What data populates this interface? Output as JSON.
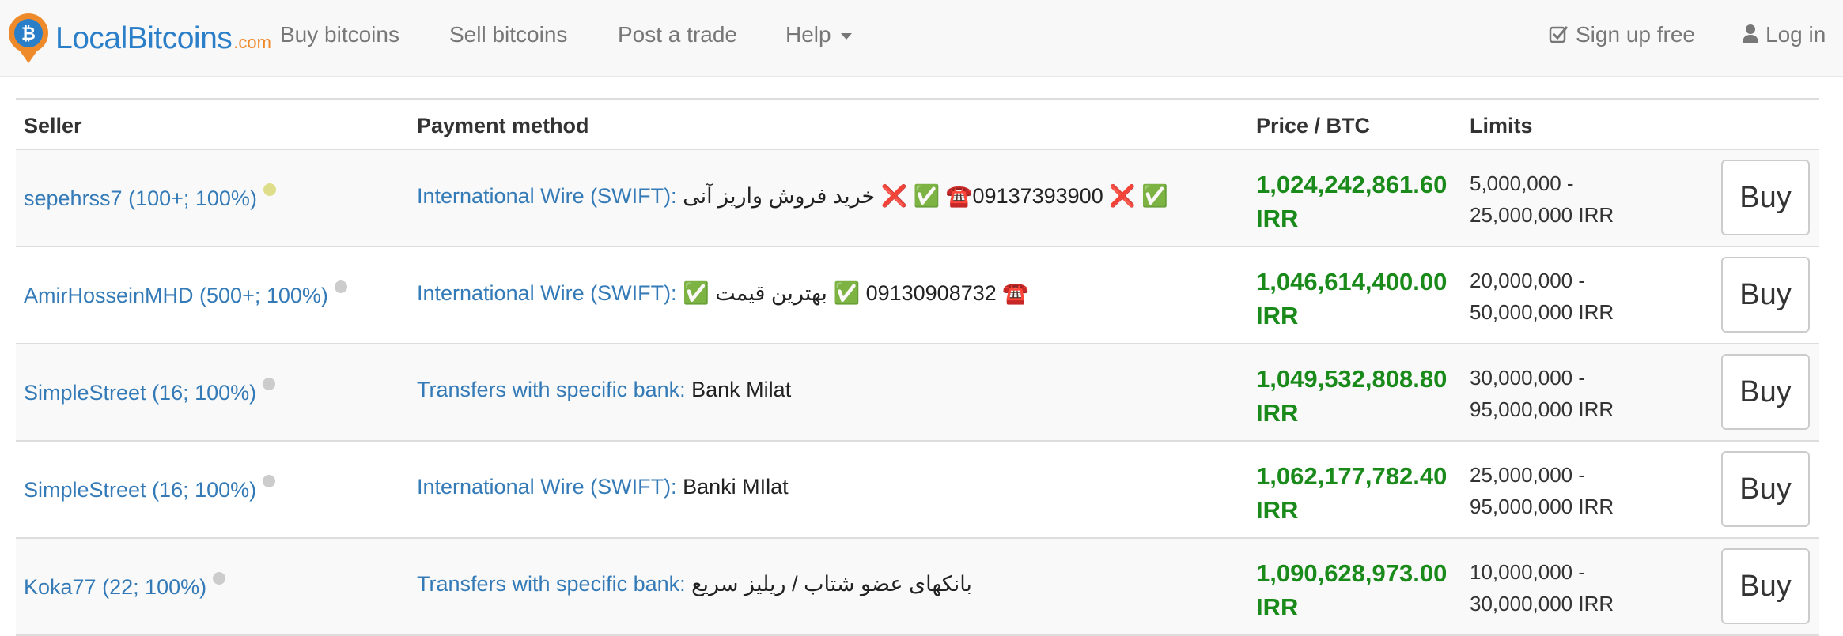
{
  "brand": {
    "name": "LocalBitcoins",
    "tld": ".com"
  },
  "nav": {
    "buy": "Buy bitcoins",
    "sell": "Sell bitcoins",
    "post": "Post a trade",
    "help": "Help",
    "signup": "Sign up free",
    "login": "Log in"
  },
  "colors": {
    "link": "#337ab7",
    "price": "#1a8a1a",
    "brand": "#2b7fc9",
    "brand_accent": "#ef8a2b"
  },
  "table": {
    "headers": {
      "seller": "Seller",
      "payment": "Payment method",
      "price": "Price / BTC",
      "limits": "Limits"
    },
    "rows": [
      {
        "seller": "sepehrss7 (100+; 100%)",
        "status_color": "#dede8a",
        "method": "International Wire (SWIFT):",
        "details": "✅ ❌ 09137393900☎️ ✅ ❌ خرید فروش واریز آنی",
        "price": "1,024,242,861.60",
        "currency": "IRR",
        "limit_min": "5,000,000 -",
        "limit_max": "25,000,000 IRR",
        "buy": "Buy"
      },
      {
        "seller": "AmirHosseinMHD (500+; 100%)",
        "status_color": "#cccccc",
        "method": "International Wire (SWIFT):",
        "details": "☎️ 09130908732 ✅ بهترین قیمت ✅",
        "price": "1,046,614,400.00",
        "currency": "IRR",
        "limit_min": "20,000,000 -",
        "limit_max": "50,000,000 IRR",
        "buy": "Buy"
      },
      {
        "seller": "SimpleStreet (16; 100%)",
        "status_color": "#cccccc",
        "method": "Transfers with specific bank:",
        "details": "Bank Milat",
        "price": "1,049,532,808.80",
        "currency": "IRR",
        "limit_min": "30,000,000 -",
        "limit_max": "95,000,000 IRR",
        "buy": "Buy"
      },
      {
        "seller": "SimpleStreet (16; 100%)",
        "status_color": "#cccccc",
        "method": "International Wire (SWIFT):",
        "details": "Banki MIlat",
        "price": "1,062,177,782.40",
        "currency": "IRR",
        "limit_min": "25,000,000 -",
        "limit_max": "95,000,000 IRR",
        "buy": "Buy"
      },
      {
        "seller": "Koka77 (22; 100%)",
        "status_color": "#cccccc",
        "method": "Transfers with specific bank:",
        "details": "بانکهای عضو شتاب / ریلیز سریع",
        "price": "1,090,628,973.00",
        "currency": "IRR",
        "limit_min": "10,000,000 -",
        "limit_max": "30,000,000 IRR",
        "buy": "Buy"
      }
    ]
  }
}
